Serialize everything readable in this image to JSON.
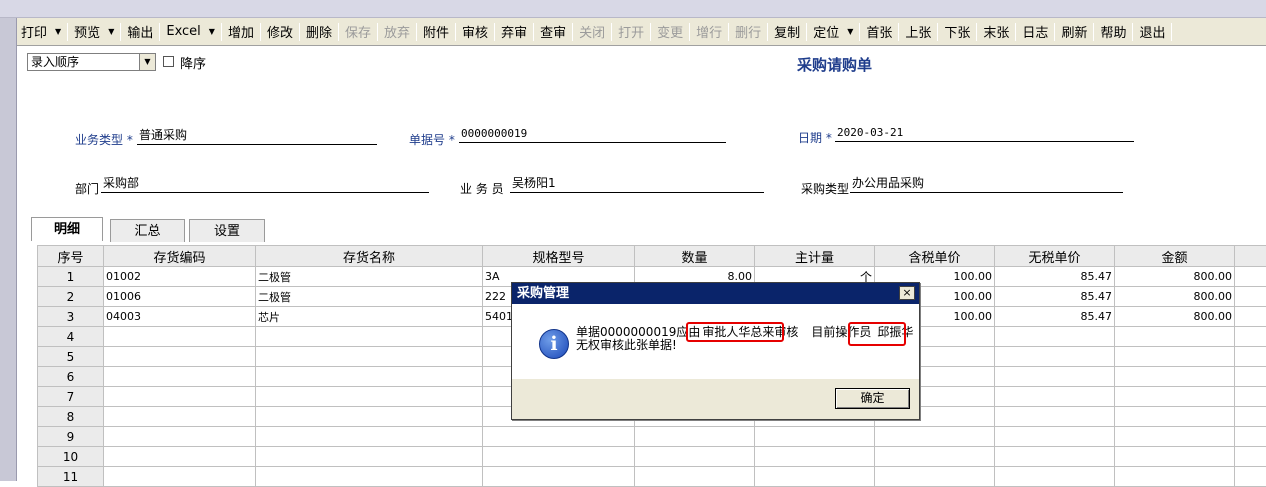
{
  "toolbar": [
    {
      "label": "打印",
      "arrow": true,
      "enabled": true
    },
    {
      "label": "预览",
      "arrow": true,
      "enabled": true
    },
    {
      "label": "输出",
      "arrow": false,
      "enabled": true
    },
    {
      "label": "Excel",
      "arrow": true,
      "enabled": true
    },
    {
      "label": "增加",
      "arrow": false,
      "enabled": true
    },
    {
      "label": "修改",
      "arrow": false,
      "enabled": true
    },
    {
      "label": "删除",
      "arrow": false,
      "enabled": true
    },
    {
      "label": "保存",
      "arrow": false,
      "enabled": false
    },
    {
      "label": "放弃",
      "arrow": false,
      "enabled": false
    },
    {
      "label": "附件",
      "arrow": false,
      "enabled": true
    },
    {
      "label": "审核",
      "arrow": false,
      "enabled": true
    },
    {
      "label": "弃审",
      "arrow": false,
      "enabled": true
    },
    {
      "label": "查审",
      "arrow": false,
      "enabled": true
    },
    {
      "label": "关闭",
      "arrow": false,
      "enabled": false
    },
    {
      "label": "打开",
      "arrow": false,
      "enabled": false
    },
    {
      "label": "变更",
      "arrow": false,
      "enabled": false
    },
    {
      "label": "增行",
      "arrow": false,
      "enabled": false
    },
    {
      "label": "删行",
      "arrow": false,
      "enabled": false
    },
    {
      "label": "复制",
      "arrow": false,
      "enabled": true
    },
    {
      "label": "定位",
      "arrow": true,
      "enabled": true
    },
    {
      "label": "首张",
      "arrow": false,
      "enabled": true
    },
    {
      "label": "上张",
      "arrow": false,
      "enabled": true
    },
    {
      "label": "下张",
      "arrow": false,
      "enabled": true
    },
    {
      "label": "末张",
      "arrow": false,
      "enabled": true
    },
    {
      "label": "日志",
      "arrow": false,
      "enabled": true
    },
    {
      "label": "刷新",
      "arrow": false,
      "enabled": true
    },
    {
      "label": "帮助",
      "arrow": false,
      "enabled": true
    },
    {
      "label": "退出",
      "arrow": false,
      "enabled": true
    }
  ],
  "sort": {
    "value": "录入顺序",
    "desc_label": "降序"
  },
  "form": {
    "title": "采购请购单",
    "biz_type_label": "业务类型",
    "biz_type_value": "普通采购",
    "doc_no_label": "单据号",
    "doc_no_value": "0000000019",
    "date_label": "日期",
    "date_value": "2020-03-21",
    "dept_label": "部门",
    "dept_value": "采购部",
    "clerk_label": "业 务 员",
    "clerk_value": "吴杨阳1",
    "purchase_type_label": "采购类型",
    "purchase_type_value": "办公用品采购",
    "required_mark": "*"
  },
  "tabs": [
    "明细",
    "汇总",
    "设置"
  ],
  "grid": {
    "headers": [
      "序号",
      "存货编码",
      "存货名称",
      "规格型号",
      "数量",
      "主计量",
      "含税单价",
      "无税单价",
      "金额"
    ],
    "rows": [
      [
        "1",
        "01002",
        "二极管",
        "3A",
        "8.00",
        "个",
        "100.00",
        "85.47",
        "800.00"
      ],
      [
        "2",
        "01006",
        "二极管",
        "222",
        "",
        "",
        "100.00",
        "85.47",
        "800.00"
      ],
      [
        "3",
        "04003",
        "芯片",
        "5401",
        "",
        "",
        "100.00",
        "85.47",
        "800.00"
      ],
      [
        "4",
        "",
        "",
        "",
        "",
        "",
        "",
        "",
        ""
      ],
      [
        "5",
        "",
        "",
        "",
        "",
        "",
        "",
        "",
        ""
      ],
      [
        "6",
        "",
        "",
        "",
        "",
        "",
        "",
        "",
        ""
      ],
      [
        "7",
        "",
        "",
        "",
        "",
        "",
        "",
        "",
        ""
      ],
      [
        "8",
        "",
        "",
        "",
        "",
        "",
        "",
        "",
        ""
      ],
      [
        "9",
        "",
        "",
        "",
        "",
        "",
        "",
        "",
        ""
      ],
      [
        "10",
        "",
        "",
        "",
        "",
        "",
        "",
        "",
        ""
      ],
      [
        "11",
        "",
        "",
        "",
        "",
        "",
        "",
        "",
        ""
      ]
    ]
  },
  "dialog": {
    "title": "采购管理",
    "close": "×",
    "line1_a": "单据0000000019应由",
    "line1_b": "审批人华总来审核",
    "line1_c": "目前操作员",
    "line1_d": "邱振华",
    "line2": "无权审核此张单据!",
    "ok_label": "确定",
    "highlight_color": "#e60000"
  }
}
